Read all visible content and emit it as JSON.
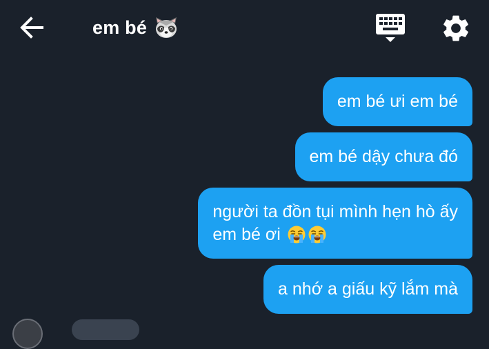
{
  "header": {
    "back_icon": "arrow-left-icon",
    "title": "em bé",
    "title_emoji": "raccoon-emoji",
    "keyboard_icon": "keyboard-icon",
    "settings_icon": "gear-icon"
  },
  "messages": [
    {
      "direction": "outgoing",
      "lines": [
        "em bé ưi em bé"
      ]
    },
    {
      "direction": "outgoing",
      "lines": [
        "em bé dậy chưa đó"
      ]
    },
    {
      "direction": "outgoing",
      "lines": [
        "người ta đồn tụi mình hẹn hò ấy",
        "em bé ơi"
      ],
      "trailing_emoji": "loudly-crying-face-emoji"
    },
    {
      "direction": "outgoing",
      "lines": [
        "a nhớ a giấu kỹ lắm mà"
      ]
    }
  ],
  "colors": {
    "background": "#1a212b",
    "outgoing_bubble": "#1da1f2",
    "text": "#ffffff"
  }
}
